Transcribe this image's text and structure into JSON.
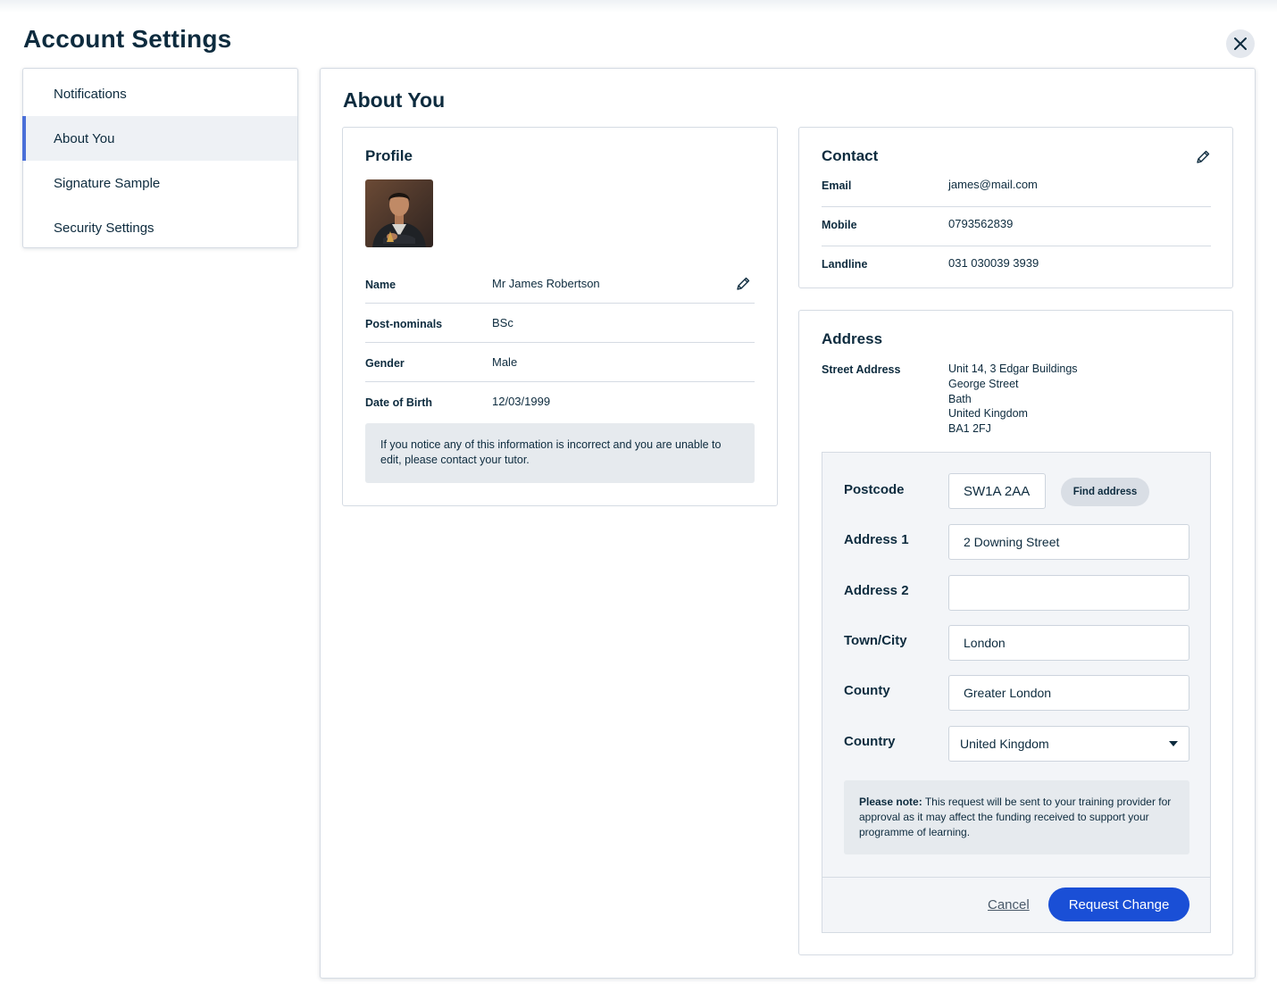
{
  "page": {
    "title": "Account Settings"
  },
  "sidebar": {
    "items": [
      {
        "label": "Notifications"
      },
      {
        "label": "About You"
      },
      {
        "label": "Signature Sample"
      },
      {
        "label": "Security Settings"
      }
    ],
    "active": "About You"
  },
  "main": {
    "title": "About You"
  },
  "profile": {
    "title": "Profile",
    "rows": [
      {
        "label": "Name",
        "value": "Mr James Robertson"
      },
      {
        "label": "Post-nominals",
        "value": "BSc"
      },
      {
        "label": "Gender",
        "value": "Male"
      },
      {
        "label": "Date of Birth",
        "value": "12/03/1999"
      }
    ],
    "info": "If you notice any of this information is incorrect and you are unable to edit, please contact your tutor."
  },
  "contact": {
    "title": "Contact",
    "rows": [
      {
        "label": "Email",
        "value": "james@mail.com"
      },
      {
        "label": "Mobile",
        "value": "0793562839"
      },
      {
        "label": "Landline",
        "value": "031 030039 3939"
      }
    ]
  },
  "address": {
    "title": "Address",
    "street_label": "Street Address",
    "street_lines": [
      "Unit 14, 3 Edgar Buildings",
      "George Street",
      "Bath",
      "United Kingdom",
      "BA1 2FJ"
    ],
    "form": {
      "postcode_label": "Postcode",
      "postcode_value": "SW1A 2AA",
      "find_label": "Find address",
      "address1_label": "Address 1",
      "address1_value": "2 Downing Street",
      "address2_label": "Address 2",
      "address2_value": "",
      "town_label": "Town/City",
      "town_value": "London",
      "county_label": "County",
      "county_value": "Greater London",
      "country_label": "Country",
      "country_value": "United Kingdom",
      "note_bold": "Please note:",
      "note_text": " This request will be sent to your training provider for approval as it may affect the funding received to support your programme of learning.",
      "cancel_label": "Cancel",
      "submit_label": "Request Change"
    }
  },
  "colors": {
    "primary": "#1a4fd6",
    "text": "#0d2b3e",
    "active_indicator": "#4a6fd8"
  }
}
